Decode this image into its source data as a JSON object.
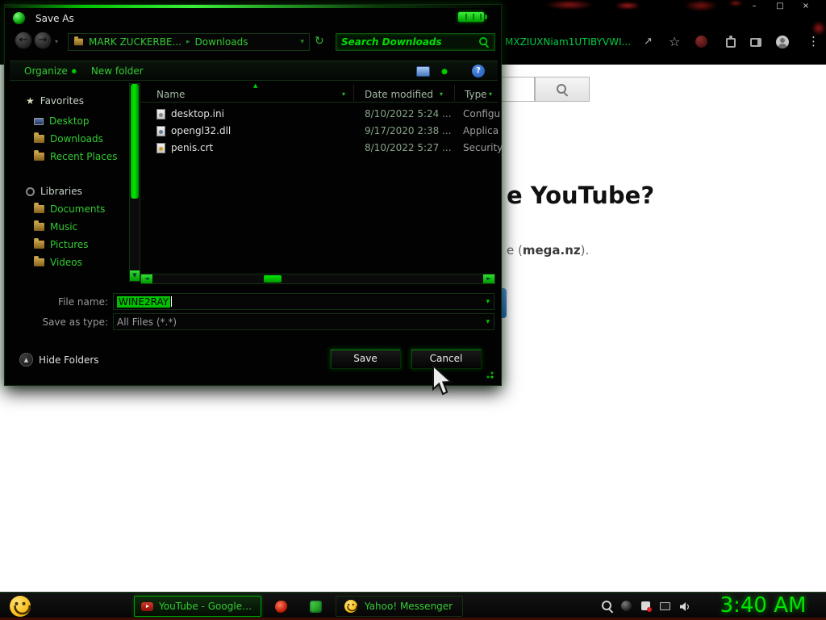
{
  "icons": {
    "back": "←",
    "forward": "→",
    "dropdown": "▾",
    "crumb_sep": "▸",
    "refresh": "↻",
    "sort_asc": "▲",
    "scroll_left": "◄",
    "scroll_right": "►",
    "scroll_down": "▼",
    "hide_up": "▲",
    "minimize": "–",
    "maximize": "□",
    "close": "×",
    "share": "↗",
    "bookmark_star": "☆",
    "menu": "⋮",
    "help": "?",
    "bullet": "●",
    "favorites_star": "★"
  },
  "browser": {
    "address_text": "MXZIUXNiam1UTIBYVWI...",
    "page": {
      "search_value": "",
      "heading_fragment": "e YouTube?",
      "body_prefix": "e (",
      "body_link": "mega.nz",
      "body_suffix": ")."
    }
  },
  "dialog": {
    "title": "Save As",
    "nav": {
      "breadcrumb_user": "MARK ZUCKERBE...",
      "breadcrumb_folder": "Downloads",
      "search_placeholder": "Search Downloads"
    },
    "toolbar": {
      "organize_label": "Organize",
      "new_folder_label": "New folder"
    },
    "sidebar": {
      "favorites_header": "Favorites",
      "favorites_items": [
        {
          "label": "Desktop"
        },
        {
          "label": "Downloads"
        },
        {
          "label": "Recent Places"
        }
      ],
      "libraries_header": "Libraries",
      "libraries_items": [
        {
          "label": "Documents"
        },
        {
          "label": "Music"
        },
        {
          "label": "Pictures"
        },
        {
          "label": "Videos"
        }
      ]
    },
    "list": {
      "columns": {
        "name": "Name",
        "date": "Date modified",
        "type": "Type"
      },
      "rows": [
        {
          "name": "desktop.ini",
          "date": "8/10/2022 5:24 ...",
          "type": "Configu"
        },
        {
          "name": "opengl32.dll",
          "date": "9/17/2020 2:38 ...",
          "type": "Applica"
        },
        {
          "name": "penis.crt",
          "date": "8/10/2022 5:27 ...",
          "type": "Security"
        }
      ]
    },
    "fields": {
      "file_name_label": "File name:",
      "file_name_value": "WINE2RAY",
      "save_type_label": "Save as type:",
      "save_type_value": "All Files (*.*)"
    },
    "footer": {
      "hide_folders_label": "Hide Folders",
      "save_label": "Save",
      "cancel_label": "Cancel"
    }
  },
  "taskbar": {
    "items": [
      {
        "label": "YouTube - Google C..."
      },
      {
        "label": "Yahoo! Messenger"
      }
    ],
    "clock": "3:40 AM"
  },
  "colors": {
    "accent": "#00cc00",
    "accent_text": "#33cc33",
    "highlight": "#00c000",
    "clock_green": "#00e400",
    "page_bg": "#ffffff",
    "blue_button": "#2f80dd",
    "taskbar_maroon": "#3c0c04"
  }
}
